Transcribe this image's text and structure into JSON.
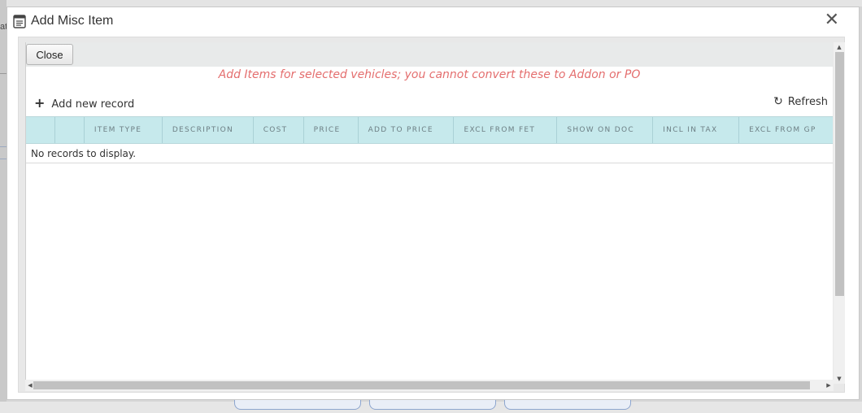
{
  "background": {
    "left_text": "at"
  },
  "window": {
    "title": "Add Misc Item",
    "title_icon": "document-list-icon",
    "close_glyph": "✕"
  },
  "toolbar": {
    "close_label": "Close"
  },
  "notice": "Add Items for selected vehicles; you cannot convert these to Addon or PO",
  "grid_toolbar": {
    "add_label": "Add new record",
    "add_glyph": "+",
    "refresh_label": "Refresh",
    "refresh_glyph": "↻"
  },
  "grid": {
    "columns": [
      "",
      "",
      "ITEM TYPE",
      "DESCRIPTION",
      "COST",
      "PRICE",
      "ADD TO PRICE",
      "EXCL FROM FET",
      "SHOW ON DOC",
      "INCL IN TAX",
      "EXCL FROM GP"
    ],
    "empty_message": "No records to display."
  },
  "scroll": {
    "up": "▲",
    "down": "▼",
    "left": "◀",
    "right": "▶"
  },
  "colors": {
    "notice": "#e46e6e",
    "header_bg": "#c6e9ec",
    "header_text": "#6d7f84"
  }
}
